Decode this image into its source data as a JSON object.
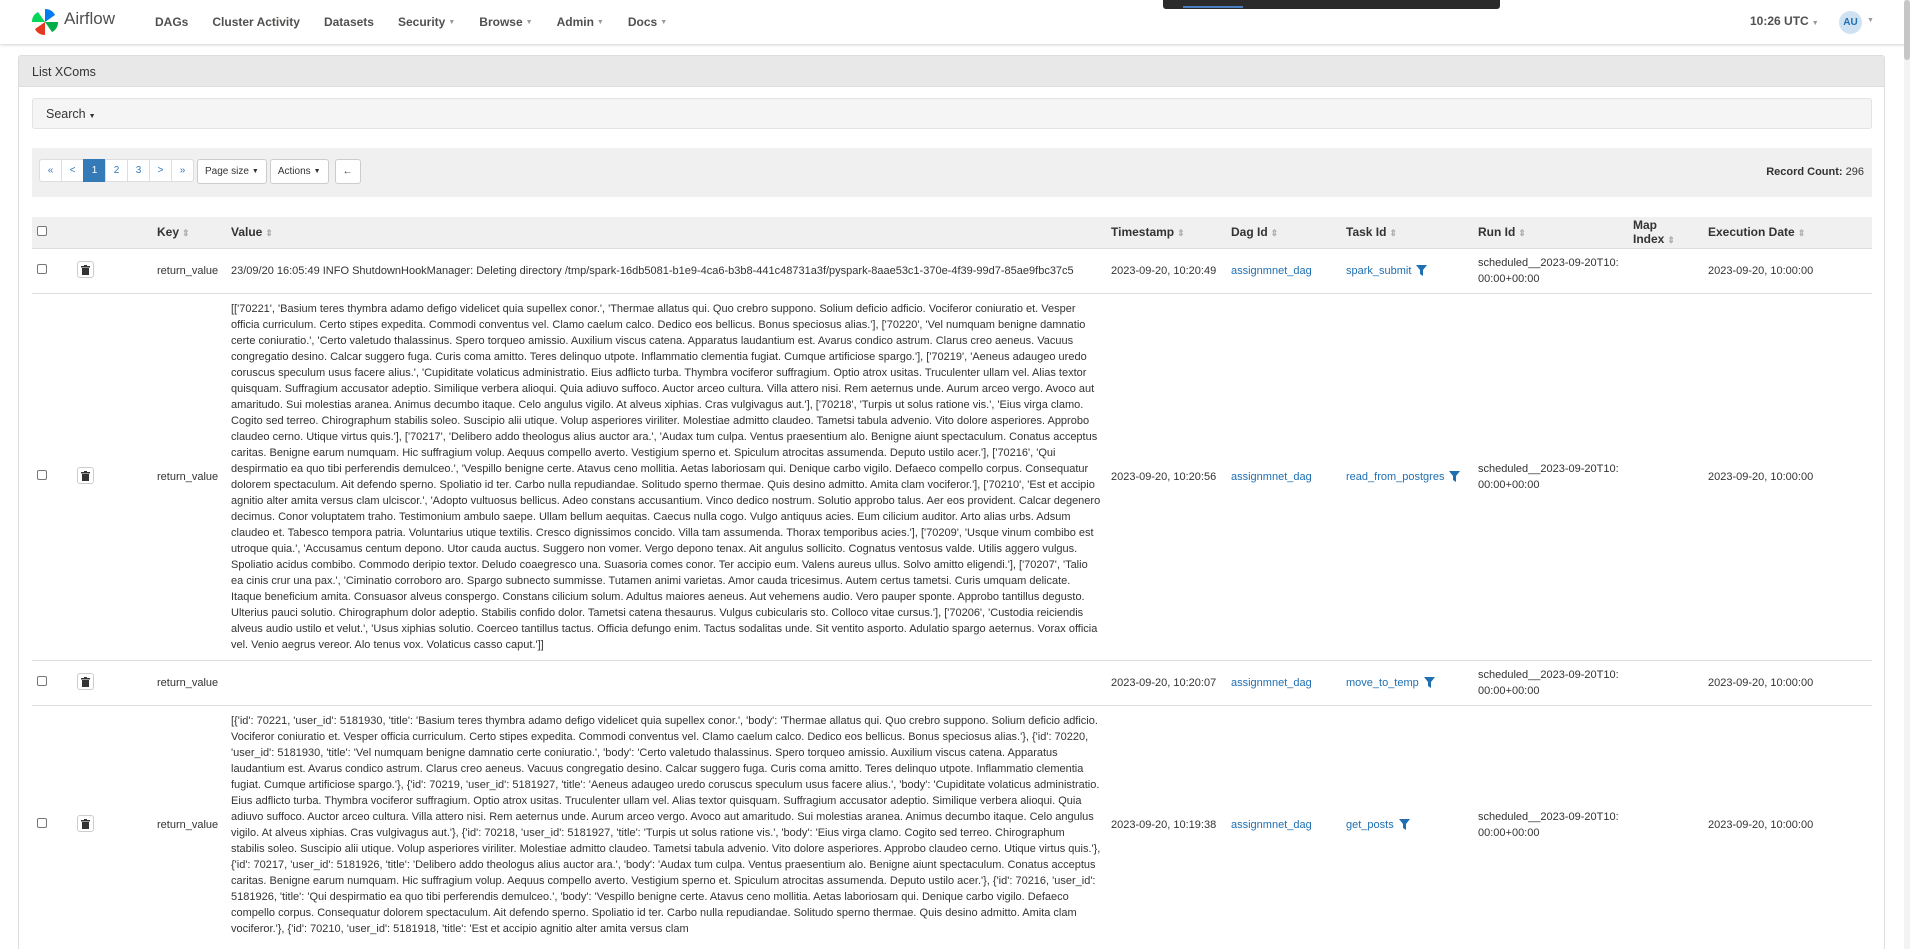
{
  "nav": {
    "brand": "Airflow",
    "items": [
      {
        "label": "DAGs",
        "dropdown": false
      },
      {
        "label": "Cluster Activity",
        "dropdown": false
      },
      {
        "label": "Datasets",
        "dropdown": false
      },
      {
        "label": "Security",
        "dropdown": true
      },
      {
        "label": "Browse",
        "dropdown": true
      },
      {
        "label": "Admin",
        "dropdown": true
      },
      {
        "label": "Docs",
        "dropdown": true
      }
    ],
    "clock": "10:26 UTC",
    "user_initials": "AU"
  },
  "panel": {
    "title": "List XComs",
    "search_label": "Search",
    "record_count_label": "Record Count:",
    "record_count": "296"
  },
  "pagination": {
    "first": "«",
    "prev": "<",
    "pages": [
      "1",
      "2",
      "3"
    ],
    "next": ">",
    "last": "»",
    "page_size": "Page size",
    "actions": "Actions",
    "back": "←"
  },
  "table": {
    "columns": {
      "key": "Key",
      "value": "Value",
      "timestamp": "Timestamp",
      "dag_id": "Dag Id",
      "task_id": "Task Id",
      "run_id": "Run Id",
      "map_index": "Map Index",
      "execution_date": "Execution Date"
    },
    "rows": [
      {
        "key": "return_value",
        "value": "23/09/20 16:05:49 INFO ShutdownHookManager: Deleting directory /tmp/spark-16db5081-b1e9-4ca6-b3b8-441c48731a3f/pyspark-8aae53c1-370e-4f39-99d7-85ae9fbc37c5",
        "timestamp": "2023-09-20, 10:20:49",
        "dag_id": "assignmnet_dag",
        "task_id": "spark_submit",
        "run_id": "scheduled__2023-09-20T10:00:00+00:00",
        "map_index": "",
        "execution_date": "2023-09-20, 10:00:00"
      },
      {
        "key": "return_value",
        "value": "[['70221', 'Basium teres thymbra adamo defigo videlicet quia supellex conor.', 'Thermae allatus qui. Quo crebro suppono. Solium deficio adficio. Vociferor coniuratio et. Vesper officia curriculum. Certo stipes expedita. Commodi conventus vel. Clamo caelum calco. Dedico eos bellicus. Bonus speciosus alias.'], ['70220', 'Vel numquam benigne damnatio certe coniuratio.', 'Certo valetudo thalassinus. Spero torqueo amissio. Auxilium viscus catena. Apparatus laudantium est. Avarus condico astrum. Clarus creo aeneus. Vacuus congregatio desino. Calcar suggero fuga. Curis coma amitto. Teres delinquo utpote. Inflammatio clementia fugiat. Cumque artificiose spargo.'], ['70219', 'Aeneus adaugeo uredo coruscus speculum usus facere alius.', 'Cupiditate volaticus administratio. Eius adflicto turba. Thymbra vociferor suffragium. Optio atrox usitas. Truculenter ullam vel. Alias textor quisquam. Suffragium accusator adeptio. Similique verbera alioqui. Quia adiuvo suffoco. Auctor arceo cultura. Villa attero nisi. Rem aeternus unde. Aurum arceo vergo. Avoco aut amaritudo. Sui molestias aranea. Animus decumbo itaque. Celo angulus vigilo. At alveus xiphias. Cras vulgivagus aut.'], ['70218', 'Turpis ut solus ratione vis.', 'Eius virga clamo. Cogito sed terreo. Chirographum stabilis soleo. Suscipio alii utique. Volup asperiores viriliter. Molestiae admitto claudeo. Tametsi tabula advenio. Vito dolore asperiores. Approbo claudeo cerno. Utique virtus quis.'], ['70217', 'Delibero addo theologus alius auctor ara.', 'Audax tum culpa. Ventus praesentium alo. Benigne aiunt spectaculum. Conatus acceptus caritas. Benigne earum numquam. Hic suffragium volup. Aequus compello averto. Vestigium sperno et. Spiculum atrocitas assumenda. Deputo ustilo acer.'], ['70216', 'Qui despirmatio ea quo tibi perferendis demulceo.', 'Vespillo benigne certe. Atavus ceno mollitia. Aetas laboriosam qui. Denique carbo vigilo. Defaeco compello corpus. Consequatur dolorem spectaculum. Ait defendo sperno. Spoliatio id ter. Carbo nulla repudiandae. Solitudo sperno thermae. Quis desino admitto. Amita clam vociferor.'], ['70210', 'Est et accipio agnitio alter amita versus clam ulciscor.', 'Adopto vultuosus bellicus. Adeo constans accusantium. Vinco dedico nostrum. Solutio approbo talus. Aer eos provident. Calcar degenero decimus. Conor voluptatem traho. Testimonium ambulo saepe. Ullam bellum aequitas. Caecus nulla cogo. Vulgo antiquus acies. Eum cilicium auditor. Arto alias urbs. Adsum claudeo et. Tabesco tempora patria. Voluntarius utique textilis. Cresco dignissimos concido. Villa tam assumenda. Thorax temporibus acies.'], ['70209', 'Usque vinum combibo est utroque quia.', 'Accusamus centum depono. Utor cauda auctus. Suggero non vomer. Vergo depono tenax. Ait angulus sollicito. Cognatus ventosus valde. Utilis aggero vulgus. Spoliatio acidus combibo. Commodo deripio textor. Deludo coaegresco una. Suasoria comes conor. Ter accipio eum. Valens aureus ullus. Solvo amitto eligendi.'], ['70207', 'Talio ea cinis crur una pax.', 'Ciminatio corroboro aro. Spargo subnecto summisse. Tutamen animi varietas. Amor cauda tricesimus. Autem certus tametsi. Curis umquam delicate. Itaque beneficium amita. Consuasor alveus conspergo. Constans cilicium solum. Adultus maiores aeneus. Aut vehemens audio. Vero pauper sponte. Approbo tantillus degusto. Ulterius pauci solutio. Chirographum dolor adeptio. Stabilis confido dolor. Tametsi catena thesaurus. Vulgus cubicularis sto. Colloco vitae cursus.'], ['70206', 'Custodia reiciendis alveus audio ustilo et velut.', 'Usus xiphias solutio. Coerceo tantillus tactus. Officia defungo enim. Tactus sodalitas unde. Sit ventito asporto. Adulatio spargo aeternus. Vorax officia vel. Venio aegrus vereor. Alo tenus vox. Volaticus casso caput.']]",
        "timestamp": "2023-09-20, 10:20:56",
        "dag_id": "assignmnet_dag",
        "task_id": "read_from_postgres",
        "run_id": "scheduled__2023-09-20T10:00:00+00:00",
        "map_index": "",
        "execution_date": "2023-09-20, 10:00:00"
      },
      {
        "key": "return_value",
        "value": "",
        "timestamp": "2023-09-20, 10:20:07",
        "dag_id": "assignmnet_dag",
        "task_id": "move_to_temp",
        "run_id": "scheduled__2023-09-20T10:00:00+00:00",
        "map_index": "",
        "execution_date": "2023-09-20, 10:00:00"
      },
      {
        "key": "return_value",
        "value": "[{'id': 70221, 'user_id': 5181930, 'title': 'Basium teres thymbra adamo defigo videlicet quia supellex conor.', 'body': 'Thermae allatus qui. Quo crebro suppono. Solium deficio adficio. Vociferor coniuratio et. Vesper officia curriculum. Certo stipes expedita. Commodi conventus vel. Clamo caelum calco. Dedico eos bellicus. Bonus speciosus alias.'}, {'id': 70220, 'user_id': 5181930, 'title': 'Vel numquam benigne damnatio certe coniuratio.', 'body': 'Certo valetudo thalassinus. Spero torqueo amissio. Auxilium viscus catena. Apparatus laudantium est. Avarus condico astrum. Clarus creo aeneus. Vacuus congregatio desino. Calcar suggero fuga. Curis coma amitto. Teres delinquo utpote. Inflammatio clementia fugiat. Cumque artificiose spargo.'}, {'id': 70219, 'user_id': 5181927, 'title': 'Aeneus adaugeo uredo coruscus speculum usus facere alius.', 'body': 'Cupiditate volaticus administratio. Eius adflicto turba. Thymbra vociferor suffragium. Optio atrox usitas. Truculenter ullam vel. Alias textor quisquam. Suffragium accusator adeptio. Similique verbera alioqui. Quia adiuvo suffoco. Auctor arceo cultura. Villa attero nisi. Rem aeternus unde. Aurum arceo vergo. Avoco aut amaritudo. Sui molestias aranea. Animus decumbo itaque. Celo angulus vigilo. At alveus xiphias. Cras vulgivagus aut.'}, {'id': 70218, 'user_id': 5181927, 'title': 'Turpis ut solus ratione vis.', 'body': 'Eius virga clamo. Cogito sed terreo. Chirographum stabilis soleo. Suscipio alii utique. Volup asperiores viriliter. Molestiae admitto claudeo. Tametsi tabula advenio. Vito dolore asperiores. Approbo claudeo cerno. Utique virtus quis.'}, {'id': 70217, 'user_id': 5181926, 'title': 'Delibero addo theologus alius auctor ara.', 'body': 'Audax tum culpa. Ventus praesentium alo. Benigne aiunt spectaculum. Conatus acceptus caritas. Benigne earum numquam. Hic suffragium volup. Aequus compello averto. Vestigium sperno et. Spiculum atrocitas assumenda. Deputo ustilo acer.'}, {'id': 70216, 'user_id': 5181926, 'title': 'Qui despirmatio ea quo tibi perferendis demulceo.', 'body': 'Vespillo benigne certe. Atavus ceno mollitia. Aetas laboriosam qui. Denique carbo vigilo. Defaeco compello corpus. Consequatur dolorem spectaculum. Ait defendo sperno. Spoliatio id ter. Carbo nulla repudiandae. Solitudo sperno thermae. Quis desino admitto. Amita clam vociferor.'}, {'id': 70210, 'user_id': 5181918, 'title': 'Est et accipio agnitio alter amita versus clam",
        "timestamp": "2023-09-20, 10:19:38",
        "dag_id": "assignmnet_dag",
        "task_id": "get_posts",
        "run_id": "scheduled__2023-09-20T10:00:00+00:00",
        "map_index": "",
        "execution_date": "2023-09-20, 10:00:00"
      }
    ]
  }
}
